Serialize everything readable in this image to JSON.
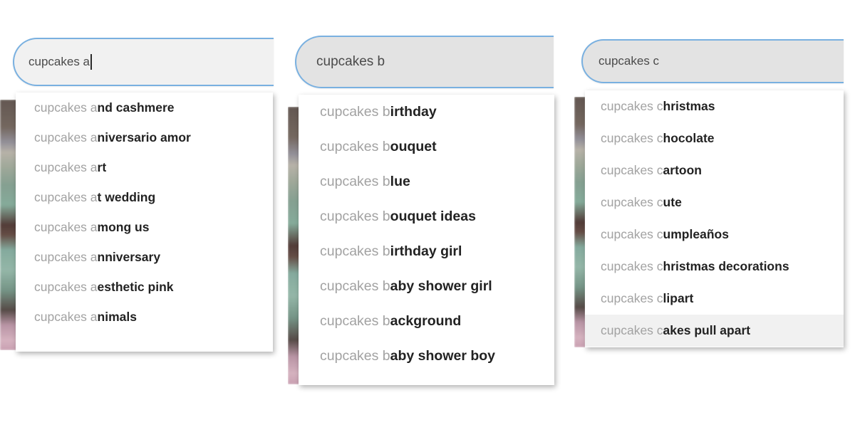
{
  "panels": [
    {
      "id": "a",
      "search": {
        "value": "cupcakes a",
        "placeholder": "Search",
        "has_caret": true
      },
      "suggestions": [
        {
          "typed": "cupcakes a",
          "rest": "nd cashmere",
          "highlighted": false
        },
        {
          "typed": "cupcakes a",
          "rest": "niversario amor",
          "highlighted": false
        },
        {
          "typed": "cupcakes a",
          "rest": "rt",
          "highlighted": false
        },
        {
          "typed": "cupcakes a",
          "rest": "t wedding",
          "highlighted": false
        },
        {
          "typed": "cupcakes a",
          "rest": "mong us",
          "highlighted": false
        },
        {
          "typed": "cupcakes a",
          "rest": "nniversary",
          "highlighted": false
        },
        {
          "typed": "cupcakes a",
          "rest": "esthetic pink",
          "highlighted": false
        },
        {
          "typed": "cupcakes a",
          "rest": "nimals",
          "highlighted": false
        }
      ]
    },
    {
      "id": "b",
      "search": {
        "value": "cupcakes b",
        "placeholder": "Search",
        "has_caret": false
      },
      "suggestions": [
        {
          "typed": "cupcakes b",
          "rest": "irthday",
          "highlighted": false
        },
        {
          "typed": "cupcakes b",
          "rest": "ouquet",
          "highlighted": false
        },
        {
          "typed": "cupcakes b",
          "rest": "lue",
          "highlighted": false
        },
        {
          "typed": "cupcakes b",
          "rest": "ouquet ideas",
          "highlighted": false
        },
        {
          "typed": "cupcakes b",
          "rest": "irthday girl",
          "highlighted": false
        },
        {
          "typed": "cupcakes b",
          "rest": "aby shower girl",
          "highlighted": false
        },
        {
          "typed": "cupcakes b",
          "rest": "ackground",
          "highlighted": false
        },
        {
          "typed": "cupcakes b",
          "rest": "aby shower boy",
          "highlighted": false
        }
      ]
    },
    {
      "id": "c",
      "search": {
        "value": "cupcakes c",
        "placeholder": "Search",
        "has_caret": false
      },
      "suggestions": [
        {
          "typed": "cupcakes c",
          "rest": "hristmas",
          "highlighted": false
        },
        {
          "typed": "cupcakes c",
          "rest": "hocolate",
          "highlighted": false
        },
        {
          "typed": "cupcakes c",
          "rest": "artoon",
          "highlighted": false
        },
        {
          "typed": "cupcakes c",
          "rest": "ute",
          "highlighted": false
        },
        {
          "typed": "cupcakes c",
          "rest": "umpleaños",
          "highlighted": false
        },
        {
          "typed": "cupcakes c",
          "rest": "hristmas decorations",
          "highlighted": false
        },
        {
          "typed": "cupcakes c",
          "rest": "lipart",
          "highlighted": false
        },
        {
          "typed": "cupcakes c",
          "rest": "akes pull apart",
          "highlighted": true
        }
      ]
    }
  ],
  "colors": {
    "focus_border": "#79b0e0",
    "field_fill_a": "#f1f1f1",
    "field_fill_bc": "#e3e3e3",
    "typed_text": "#a2a2a2",
    "suggestion_text": "#222222",
    "highlight_row": "#f1f1f1",
    "page_background": "#ffffff"
  }
}
